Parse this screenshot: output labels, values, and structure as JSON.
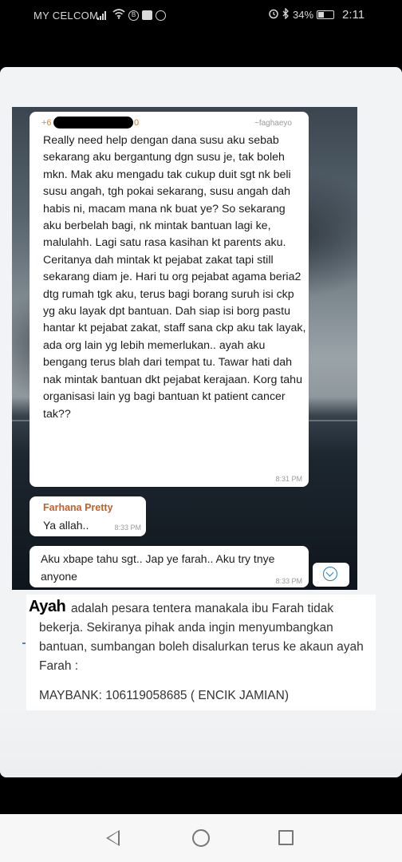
{
  "status_bar": {
    "carrier": "MY CELCOM",
    "battery": "34%",
    "battery_level": 0.34,
    "time": "2:11",
    "icons": [
      "signal-icon",
      "wifi-icon",
      "b-notification-icon",
      "gallery-icon",
      "chrome-icon",
      "alarm-icon",
      "bluetooth-icon",
      "battery-icon"
    ]
  },
  "chat": {
    "message1": {
      "sender_prefix": "+6",
      "sender_suffix": "0",
      "alias": "~faghaeyo",
      "text": "Really need help dengan dana susu aku sebab sekarang aku bergantung dgn susu je, tak boleh mkn. Mak aku mengadu tak cukup duit sgt nk beli susu angah, tgh pokai sekarang, susu angah dah habis ni, macam mana nk buat ye? So sekarang aku berbelah bagi, nk mintak bantuan lagi ke, malulahh. Lagi satu rasa kasihan kt parents aku. Ceritanya dah mintak kt pejabat zakat tapi still sekarang diam je. Hari tu org pejabat agama beria2 dtg rumah tgk aku, terus bagi borang suruh isi ckp yg aku layak dpt bantuan. Dah siap isi borg pastu hantar kt pejabat zakat, staff sana ckp aku tak layak, ada org lain yg lebih memerlukan.. ayah aku bengang terus blah dari tempat tu. Tawar hati dah nak mintak bantuan dkt pejabat kerajaan. Korg tahu organisasi lain yg bagi bantuan kt patient cancer tak??",
      "time": "8:31 PM"
    },
    "message2": {
      "sender": "Farhana Pretty",
      "text": "Ya allah..",
      "time": "8:33 PM"
    },
    "message3": {
      "text": "Aku xbape tahu sgt.. Jap ye farah.. Aku try tnye anyone",
      "time": "8:33 PM"
    }
  },
  "article": {
    "heading_word": "Ayah",
    "text": "adalah pesara tentera manakala ibu Farah tidak bekerja. Sekiranya pihak anda ingin menyumbangkan bantuan, sumbangan boleh disalurkan terus ke akaun ayah Farah :",
    "bank_line": "MAYBANK: 106119058685 ( ENCIK JAMIAN)"
  },
  "colors": {
    "sender_orange": "#e08a3c",
    "sender2_color": "#c45f2c",
    "scroll_button_blue": "#2a7ab8"
  }
}
